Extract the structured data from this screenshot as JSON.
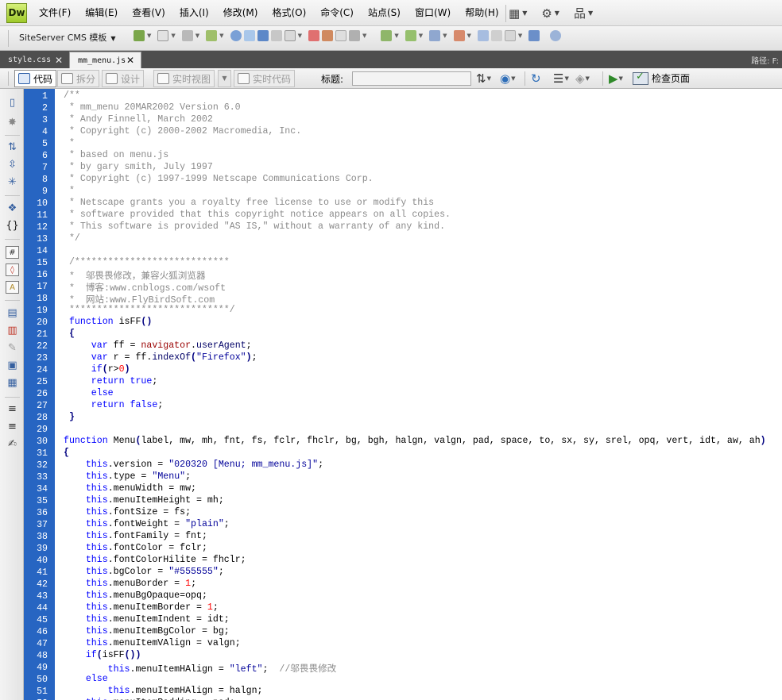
{
  "app": {
    "logo": "Dw"
  },
  "menubar": {
    "items": [
      "文件(F)",
      "编辑(E)",
      "查看(V)",
      "插入(I)",
      "修改(M)",
      "格式(O)",
      "命令(C)",
      "站点(S)",
      "窗口(W)",
      "帮助(H)"
    ],
    "tools": [
      {
        "icon": "layout-icon",
        "glyph": "▦"
      },
      {
        "icon": "gear-icon",
        "glyph": "⚙"
      },
      {
        "icon": "site-manager-icon",
        "glyph": "品"
      }
    ]
  },
  "insert_toolbar": {
    "category": "SiteServer CMS 模板"
  },
  "tabs": [
    {
      "label": "style.css",
      "active": false
    },
    {
      "label": "mm_menu.js",
      "active": true
    }
  ],
  "path_label": "路径:  F:",
  "doc_toolbar": {
    "code": "代码",
    "split": "拆分",
    "design": "设计",
    "live_view": "实时视图",
    "live_code": "实时代码",
    "title_label": "标题:",
    "title_value": "",
    "check_page": "检查页面"
  },
  "colors": {
    "gutter": "#2765c2",
    "tabbar": "#4e4e4e",
    "comment": "#8a8a8a",
    "keyword": "#0000ff",
    "string": "#000099",
    "number": "#ff0000"
  },
  "code": {
    "lines": [
      [
        [
          "c",
          "/**"
        ]
      ],
      [
        [
          "c",
          " * mm_menu 20MAR2002 Version 6.0"
        ]
      ],
      [
        [
          "c",
          " * Andy Finnell, March 2002"
        ]
      ],
      [
        [
          "c",
          " * Copyright (c) 2000-2002 Macromedia, Inc."
        ]
      ],
      [
        [
          "c",
          " *"
        ]
      ],
      [
        [
          "c",
          " * based on menu.js"
        ]
      ],
      [
        [
          "c",
          " * by gary smith, July 1997"
        ]
      ],
      [
        [
          "c",
          " * Copyright (c) 1997-1999 Netscape Communications Corp."
        ]
      ],
      [
        [
          "c",
          " *"
        ]
      ],
      [
        [
          "c",
          " * Netscape grants you a royalty free license to use or modify this"
        ]
      ],
      [
        [
          "c",
          " * software provided that this copyright notice appears on all copies."
        ]
      ],
      [
        [
          "c",
          " * This software is provided \"AS IS,\" without a warranty of any kind."
        ]
      ],
      [
        [
          "c",
          " */"
        ]
      ],
      [],
      [
        [
          "c",
          " /****************************"
        ]
      ],
      [
        [
          "c",
          " *  邬畏畏修改，兼容火狐浏览器"
        ]
      ],
      [
        [
          "c",
          " *  博客:www.cnblogs.com/wsoft"
        ]
      ],
      [
        [
          "c",
          " *  网站:www.FlyBirdSoft.com"
        ]
      ],
      [
        [
          "c",
          " *****************************/"
        ]
      ],
      [
        [
          "k",
          " function"
        ],
        [
          "t",
          " isFF"
        ],
        [
          "b",
          "()"
        ]
      ],
      [
        [
          "b",
          " {"
        ]
      ],
      [
        [
          "t",
          "     "
        ],
        [
          "k",
          "var"
        ],
        [
          "t",
          " ff = "
        ],
        [
          "v",
          "navigator"
        ],
        [
          "t",
          "."
        ],
        [
          "p",
          "userAgent"
        ],
        [
          "t",
          ";"
        ]
      ],
      [
        [
          "t",
          "     "
        ],
        [
          "k",
          "var"
        ],
        [
          "t",
          " r = ff."
        ],
        [
          "p",
          "indexOf"
        ],
        [
          "b",
          "("
        ],
        [
          "s",
          "\"Firefox\""
        ],
        [
          "b",
          ")"
        ],
        [
          "t",
          ";"
        ]
      ],
      [
        [
          "t",
          "     "
        ],
        [
          "k",
          "if"
        ],
        [
          "b",
          "("
        ],
        [
          "t",
          "r>"
        ],
        [
          "n",
          "0"
        ],
        [
          "b",
          ")"
        ]
      ],
      [
        [
          "t",
          "     "
        ],
        [
          "k",
          "return"
        ],
        [
          "t",
          " "
        ],
        [
          "k",
          "true"
        ],
        [
          "t",
          ";"
        ]
      ],
      [
        [
          "t",
          "     "
        ],
        [
          "k",
          "else"
        ]
      ],
      [
        [
          "t",
          "     "
        ],
        [
          "k",
          "return"
        ],
        [
          "t",
          " "
        ],
        [
          "k",
          "false"
        ],
        [
          "t",
          ";"
        ]
      ],
      [
        [
          "b",
          " }"
        ]
      ],
      [],
      [
        [
          "k",
          "function"
        ],
        [
          "t",
          " Menu"
        ],
        [
          "b",
          "("
        ],
        [
          "t",
          "label, mw, mh, fnt, fs, fclr, fhclr, bg, bgh, halgn, valgn, pad, space, to, sx, sy, srel, opq, vert, idt, aw, ah"
        ],
        [
          "b",
          ")"
        ]
      ],
      [
        [
          "b",
          "{"
        ]
      ],
      [
        [
          "t",
          "    "
        ],
        [
          "k",
          "this"
        ],
        [
          "t",
          ".version = "
        ],
        [
          "s",
          "\"020320 [Menu; mm_menu.js]\""
        ],
        [
          "t",
          ";"
        ]
      ],
      [
        [
          "t",
          "    "
        ],
        [
          "k",
          "this"
        ],
        [
          "t",
          ".type = "
        ],
        [
          "s",
          "\"Menu\""
        ],
        [
          "t",
          ";"
        ]
      ],
      [
        [
          "t",
          "    "
        ],
        [
          "k",
          "this"
        ],
        [
          "t",
          ".menuWidth = mw;"
        ]
      ],
      [
        [
          "t",
          "    "
        ],
        [
          "k",
          "this"
        ],
        [
          "t",
          ".menuItemHeight = mh;"
        ]
      ],
      [
        [
          "t",
          "    "
        ],
        [
          "k",
          "this"
        ],
        [
          "t",
          ".fontSize = fs;"
        ]
      ],
      [
        [
          "t",
          "    "
        ],
        [
          "k",
          "this"
        ],
        [
          "t",
          ".fontWeight = "
        ],
        [
          "s",
          "\"plain\""
        ],
        [
          "t",
          ";"
        ]
      ],
      [
        [
          "t",
          "    "
        ],
        [
          "k",
          "this"
        ],
        [
          "t",
          ".fontFamily = fnt;"
        ]
      ],
      [
        [
          "t",
          "    "
        ],
        [
          "k",
          "this"
        ],
        [
          "t",
          ".fontColor = fclr;"
        ]
      ],
      [
        [
          "t",
          "    "
        ],
        [
          "k",
          "this"
        ],
        [
          "t",
          ".fontColorHilite = fhclr;"
        ]
      ],
      [
        [
          "t",
          "    "
        ],
        [
          "k",
          "this"
        ],
        [
          "t",
          ".bgColor = "
        ],
        [
          "s",
          "\"#555555\""
        ],
        [
          "t",
          ";"
        ]
      ],
      [
        [
          "t",
          "    "
        ],
        [
          "k",
          "this"
        ],
        [
          "t",
          ".menuBorder = "
        ],
        [
          "n",
          "1"
        ],
        [
          "t",
          ";"
        ]
      ],
      [
        [
          "t",
          "    "
        ],
        [
          "k",
          "this"
        ],
        [
          "t",
          ".menuBgOpaque=opq;"
        ]
      ],
      [
        [
          "t",
          "    "
        ],
        [
          "k",
          "this"
        ],
        [
          "t",
          ".menuItemBorder = "
        ],
        [
          "n",
          "1"
        ],
        [
          "t",
          ";"
        ]
      ],
      [
        [
          "t",
          "    "
        ],
        [
          "k",
          "this"
        ],
        [
          "t",
          ".menuItemIndent = idt;"
        ]
      ],
      [
        [
          "t",
          "    "
        ],
        [
          "k",
          "this"
        ],
        [
          "t",
          ".menuItemBgColor = bg;"
        ]
      ],
      [
        [
          "t",
          "    "
        ],
        [
          "k",
          "this"
        ],
        [
          "t",
          ".menuItemVAlign = valgn;"
        ]
      ],
      [
        [
          "t",
          "    "
        ],
        [
          "k",
          "if"
        ],
        [
          "b",
          "("
        ],
        [
          "t",
          "isFF"
        ],
        [
          "b",
          "())"
        ]
      ],
      [
        [
          "t",
          "        "
        ],
        [
          "k",
          "this"
        ],
        [
          "t",
          ".menuItemHAlign = "
        ],
        [
          "s",
          "\"left\""
        ],
        [
          "t",
          ";  "
        ],
        [
          "c",
          "//邬畏畏修改"
        ]
      ],
      [
        [
          "t",
          "    "
        ],
        [
          "k",
          "else"
        ]
      ],
      [
        [
          "t",
          "        "
        ],
        [
          "k",
          "this"
        ],
        [
          "t",
          ".menuItemHAlign = halgn;"
        ]
      ],
      [
        [
          "t",
          "    "
        ],
        [
          "k",
          "this"
        ],
        [
          "t",
          ".menuItemPadding = pad;"
        ]
      ]
    ]
  }
}
